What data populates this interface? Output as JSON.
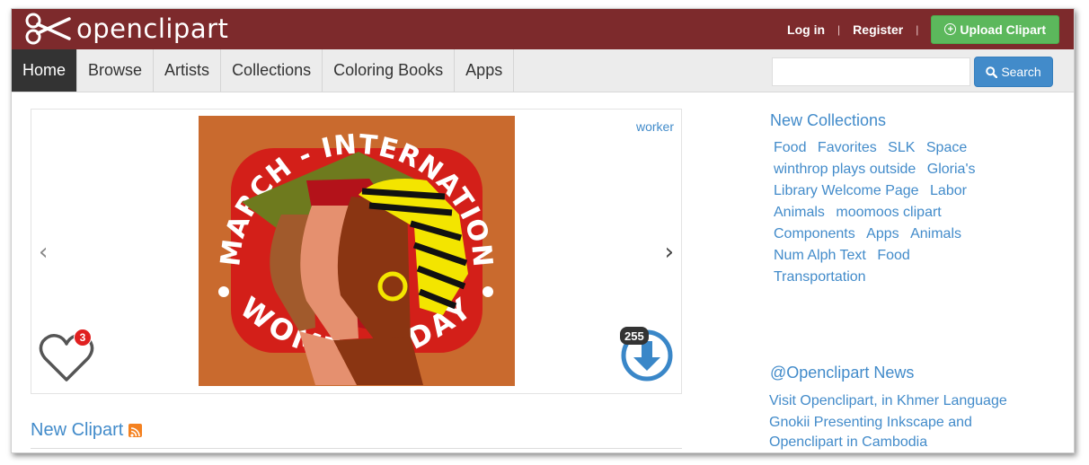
{
  "header": {
    "logo_text": "openclipart",
    "login": "Log in",
    "separator": "|",
    "register": "Register",
    "upload": "Upload Clipart"
  },
  "nav": {
    "items": [
      {
        "label": "Home",
        "active": true
      },
      {
        "label": "Browse"
      },
      {
        "label": "Artists"
      },
      {
        "label": "Collections"
      },
      {
        "label": "Coloring Books"
      },
      {
        "label": "Apps"
      }
    ],
    "search_placeholder": "",
    "search_button": "Search"
  },
  "carousel": {
    "tag": "worker",
    "prev_arrow": "‹",
    "next_arrow": "›",
    "likes": "3",
    "downloads": "255",
    "image": {
      "top_text": "8. MARCH - INTERNATIONAL",
      "bottom_text": "WOMEN'S DAY"
    }
  },
  "new_clipart": {
    "title": "New Clipart"
  },
  "sidebar": {
    "collections_title": "New Collections",
    "collections": [
      "Food",
      "Favorites",
      "SLK",
      "Space",
      "winthrop plays outside",
      "Gloria's",
      "Library Welcome Page",
      "Labor",
      "Animals",
      "moomoos clipart",
      "Components",
      "Apps",
      "Animals",
      "Num Alph Text",
      "Food",
      "Transportation"
    ],
    "news_title": "@Openclipart News",
    "news": [
      "Visit Openclipart, in Khmer Language",
      "Gnokii Presenting Inkscape and Openclipart in Cambodia"
    ]
  },
  "colors": {
    "header_bg": "#7d2a2c",
    "nav_bg": "#ececec",
    "nav_active_bg": "#333333",
    "link": "#428bca",
    "upload_green": "#5cb85c",
    "search_blue": "#428bca"
  }
}
